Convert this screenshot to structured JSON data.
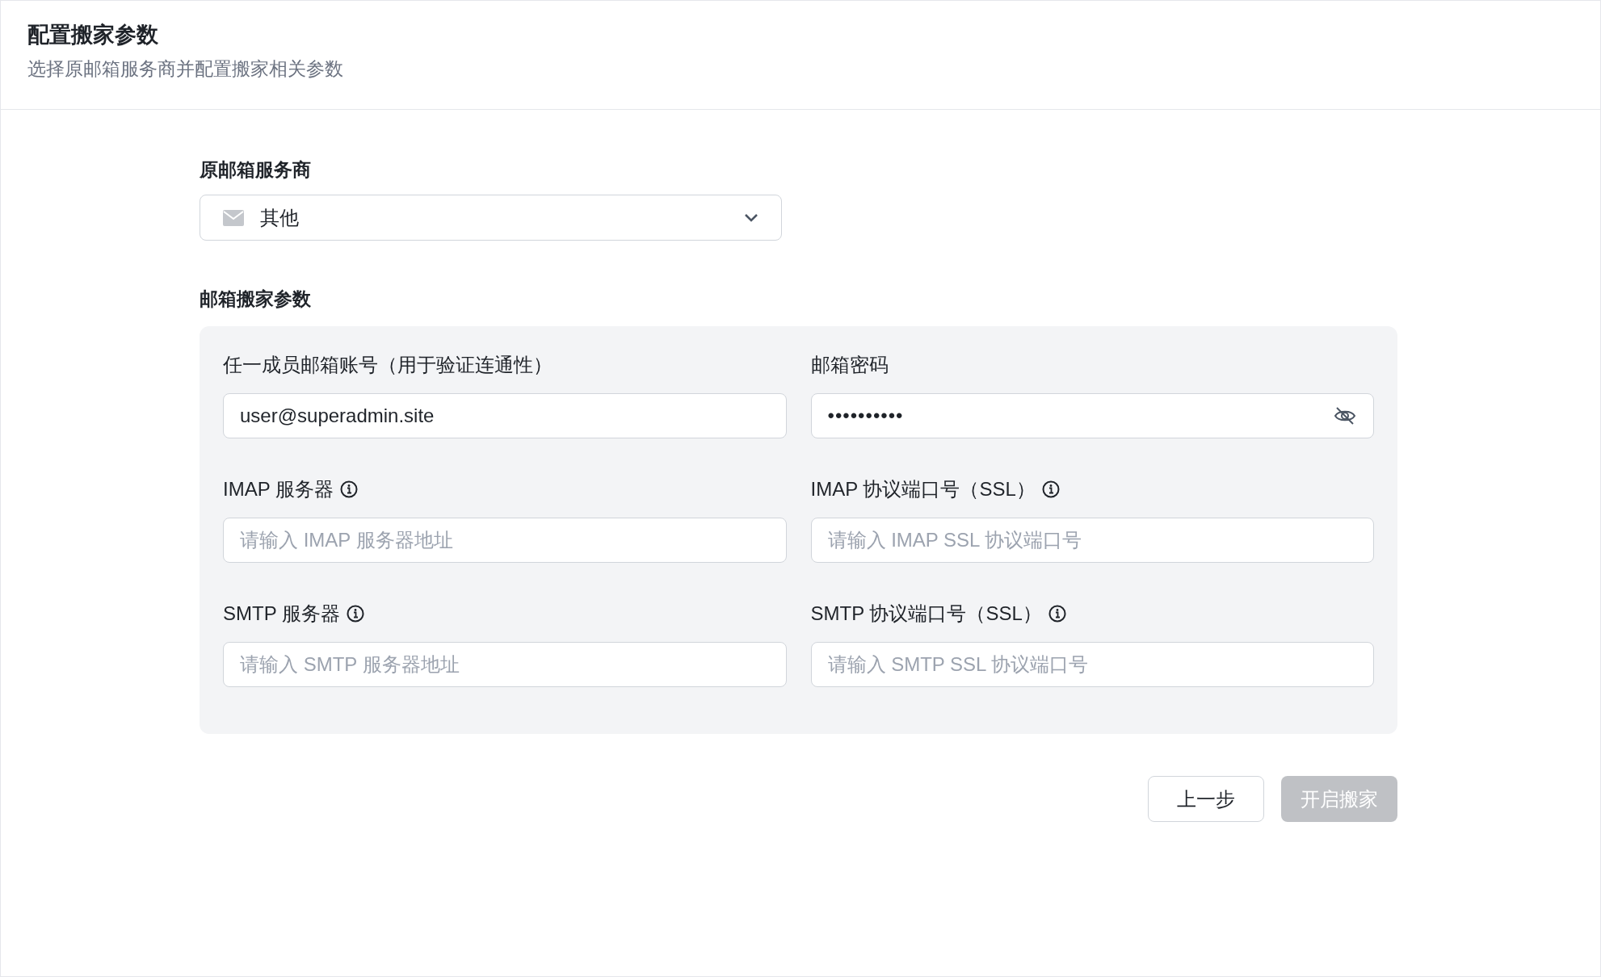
{
  "header": {
    "title": "配置搬家参数",
    "subtitle": "选择原邮箱服务商并配置搬家相关参数"
  },
  "provider": {
    "label": "原邮箱服务商",
    "value": "其他"
  },
  "params": {
    "label": "邮箱搬家参数",
    "fields": [
      {
        "label": "任一成员邮箱账号（用于验证连通性）",
        "info": false,
        "kind": "text",
        "value": "user@superadmin.site"
      },
      {
        "label": "邮箱密码",
        "info": false,
        "kind": "password",
        "value": "••••••••••"
      },
      {
        "label": "IMAP 服务器",
        "info": true,
        "kind": "text",
        "placeholder": "请输入 IMAP 服务器地址"
      },
      {
        "label": "IMAP 协议端口号（SSL）",
        "info": true,
        "kind": "text",
        "placeholder": "请输入 IMAP SSL 协议端口号"
      },
      {
        "label": "SMTP 服务器",
        "info": true,
        "kind": "text",
        "placeholder": "请输入 SMTP 服务器地址"
      },
      {
        "label": "SMTP 协议端口号（SSL）",
        "info": true,
        "kind": "text",
        "placeholder": "请输入 SMTP SSL 协议端口号"
      }
    ]
  },
  "buttons": [
    {
      "label": "上一步",
      "disabled": false
    },
    {
      "label": "开启搬家",
      "disabled": true
    }
  ]
}
